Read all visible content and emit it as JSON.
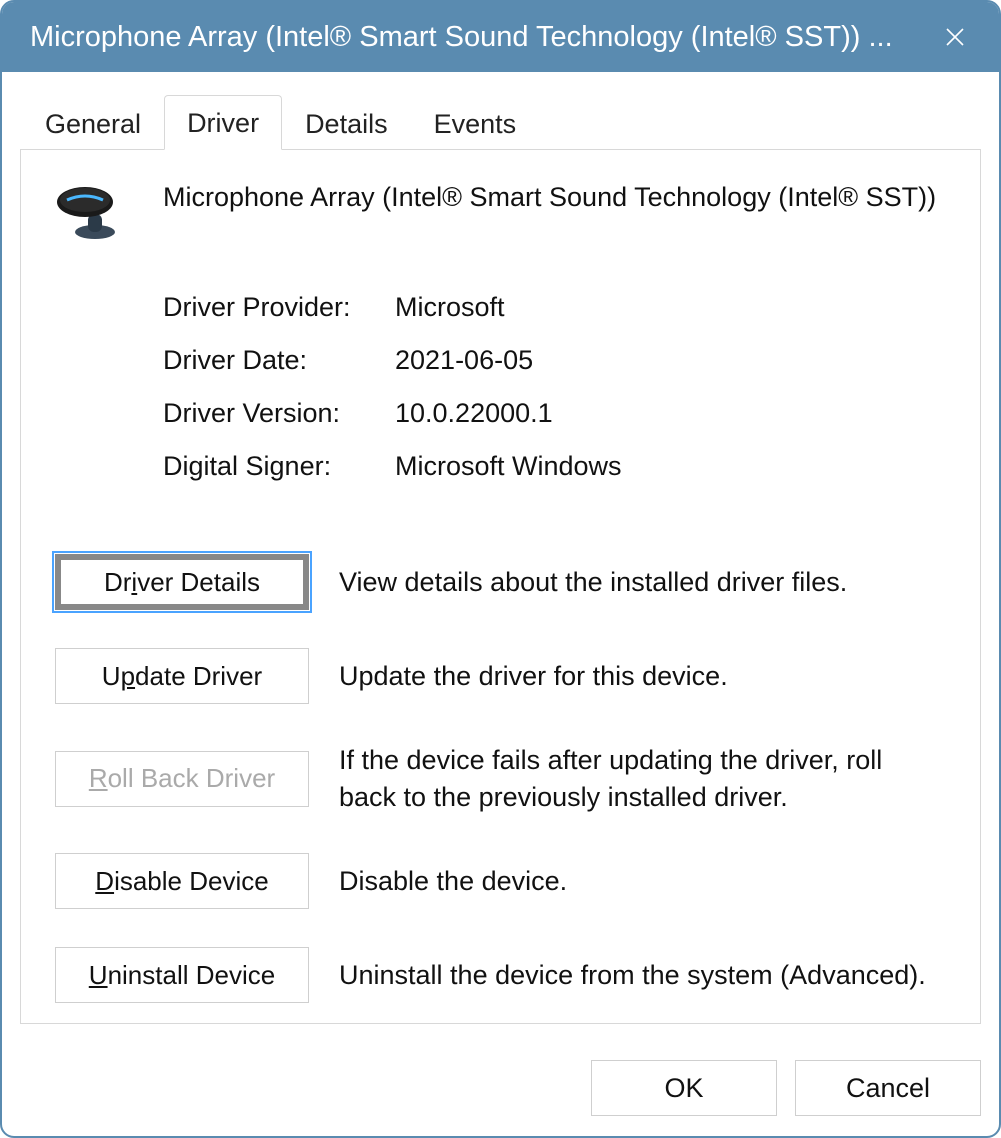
{
  "window": {
    "title": "Microphone Array (Intel® Smart Sound Technology (Intel® SST)) ..."
  },
  "tabs": {
    "general": "General",
    "driver": "Driver",
    "details": "Details",
    "events": "Events",
    "active": "driver"
  },
  "device": {
    "name": "Microphone Array (Intel® Smart Sound Technology (Intel® SST))"
  },
  "info": {
    "provider_label": "Driver Provider:",
    "provider_value": "Microsoft",
    "date_label": "Driver Date:",
    "date_value": "2021-06-05",
    "version_label": "Driver Version:",
    "version_value": "10.0.22000.1",
    "signer_label": "Digital Signer:",
    "signer_value": "Microsoft Windows"
  },
  "actions": {
    "driver_details": {
      "pre": "Dr",
      "m": "i",
      "post": "ver Details",
      "desc": "View details about the installed driver files."
    },
    "update_driver": {
      "pre": "U",
      "m": "p",
      "post": "date Driver",
      "desc": "Update the driver for this device."
    },
    "rollback_driver": {
      "pre": "",
      "m": "R",
      "post": "oll Back Driver",
      "desc": "If the device fails after updating the driver, roll back to the previously installed driver."
    },
    "disable_device": {
      "pre": "",
      "m": "D",
      "post": "isable Device",
      "desc": "Disable the device."
    },
    "uninstall_device": {
      "pre": "",
      "m": "U",
      "post": "ninstall Device",
      "desc": "Uninstall the device from the system (Advanced)."
    }
  },
  "footer": {
    "ok": "OK",
    "cancel": "Cancel"
  }
}
